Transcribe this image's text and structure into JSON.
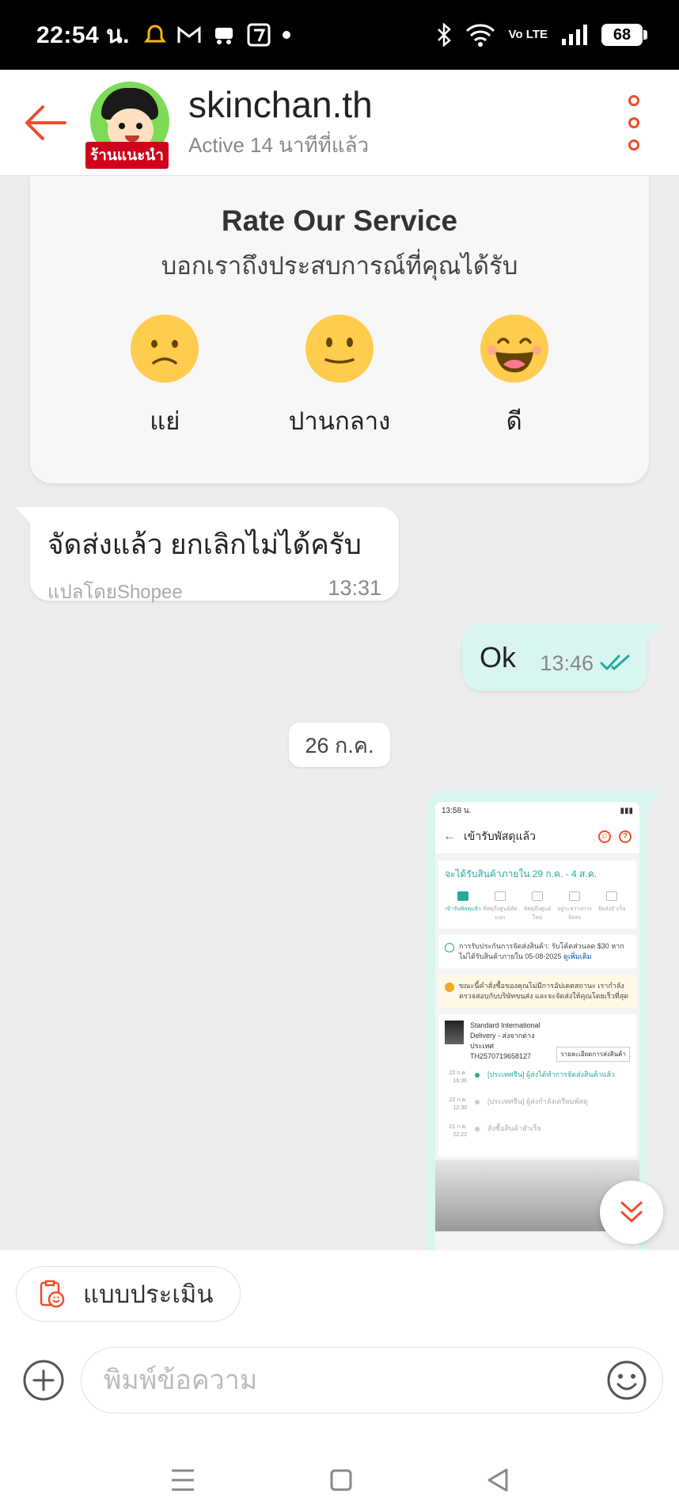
{
  "status_bar": {
    "time": "22:54 น.",
    "battery": "68",
    "volte": "Vo LTE"
  },
  "header": {
    "shop_name": "skinchan.th",
    "badge": "ร้านแนะนำ",
    "status": "Active 14 นาทีที่แล้ว"
  },
  "rating_card": {
    "title": "Rate Our Service",
    "subtitle": "บอกเราถึงประสบการณ์ที่คุณได้รับ",
    "options": [
      {
        "label": "แย่",
        "icon": "sad-face-icon"
      },
      {
        "label": "ปานกลาง",
        "icon": "neutral-face-icon"
      },
      {
        "label": "ดี",
        "icon": "happy-face-icon"
      }
    ]
  },
  "messages": {
    "incoming": {
      "text": "จัดส่งแล้ว ยกเลิกไม่ได้ครับ",
      "translated_by": "แปลโดยShopee",
      "time": "13:31"
    },
    "outgoing": {
      "text": "Ok",
      "time": "13:46"
    },
    "date_separator": "26 ก.ค."
  },
  "image_message": {
    "status_time": "13:58 น.",
    "title": "เข้ารับพัสดุแล้ว",
    "eta": "จะได้รับสินค้าภายใน 29 ก.ค. - 4 ส.ค.",
    "steps": [
      {
        "label": "เข้ารับพัสดุแล้ว",
        "active": true
      },
      {
        "label": "พัสดุถึงศูนย์คัดแยก",
        "active": false
      },
      {
        "label": "พัสดุถึงศูนย์ใหม่",
        "active": false
      },
      {
        "label": "อยู่ระหว่างการจัดส่ง",
        "active": false
      },
      {
        "label": "จัดส่งสำเร็จ",
        "active": false
      }
    ],
    "guarantee": "การรับประกันการจัดส่งสินค้า: รับโค้ดส่วนลด $30 หากไม่ได้รับสินค้าภายใน 05-08-2025",
    "guarantee_link": "ดูเพิ่มเติม",
    "warning": "ขณะนี้คำสั่งซื้อของคุณไม่มีการอัปเดตสถานะ เรากำลังตรวจสอบกับบริษัทขนส่ง และจะจัดส่งให้คุณโดยเร็วที่สุด",
    "carrier": "Standard International Delivery - ส่งจากต่างประเทศ",
    "tracking": "TH2570719658127",
    "track_button": "รายละเอียดการส่งสินค้า",
    "timeline": [
      {
        "time": "22 ก.ค. 16:36",
        "text": "[ประเทศจีน] ผู้ส่งได้ทำการจัดส่งสินค้าแล้ว",
        "active": true
      },
      {
        "time": "22 ก.ค. 12:30",
        "text": "[ประเทศจีน] ผู้ส่งกำลังเตรียมพัสดุ",
        "active": false
      },
      {
        "time": "21 ก.ค. 22:22",
        "text": "สั่งซื้อสินค้าสำเร็จ",
        "active": false
      }
    ]
  },
  "quick_reply": {
    "label": "แบบประเมิน"
  },
  "composer": {
    "placeholder": "พิมพ์ข้อความ"
  },
  "colors": {
    "accent": "#ee4d2d",
    "outgoing_bubble": "#d9f5f0",
    "teal": "#26aa99"
  }
}
